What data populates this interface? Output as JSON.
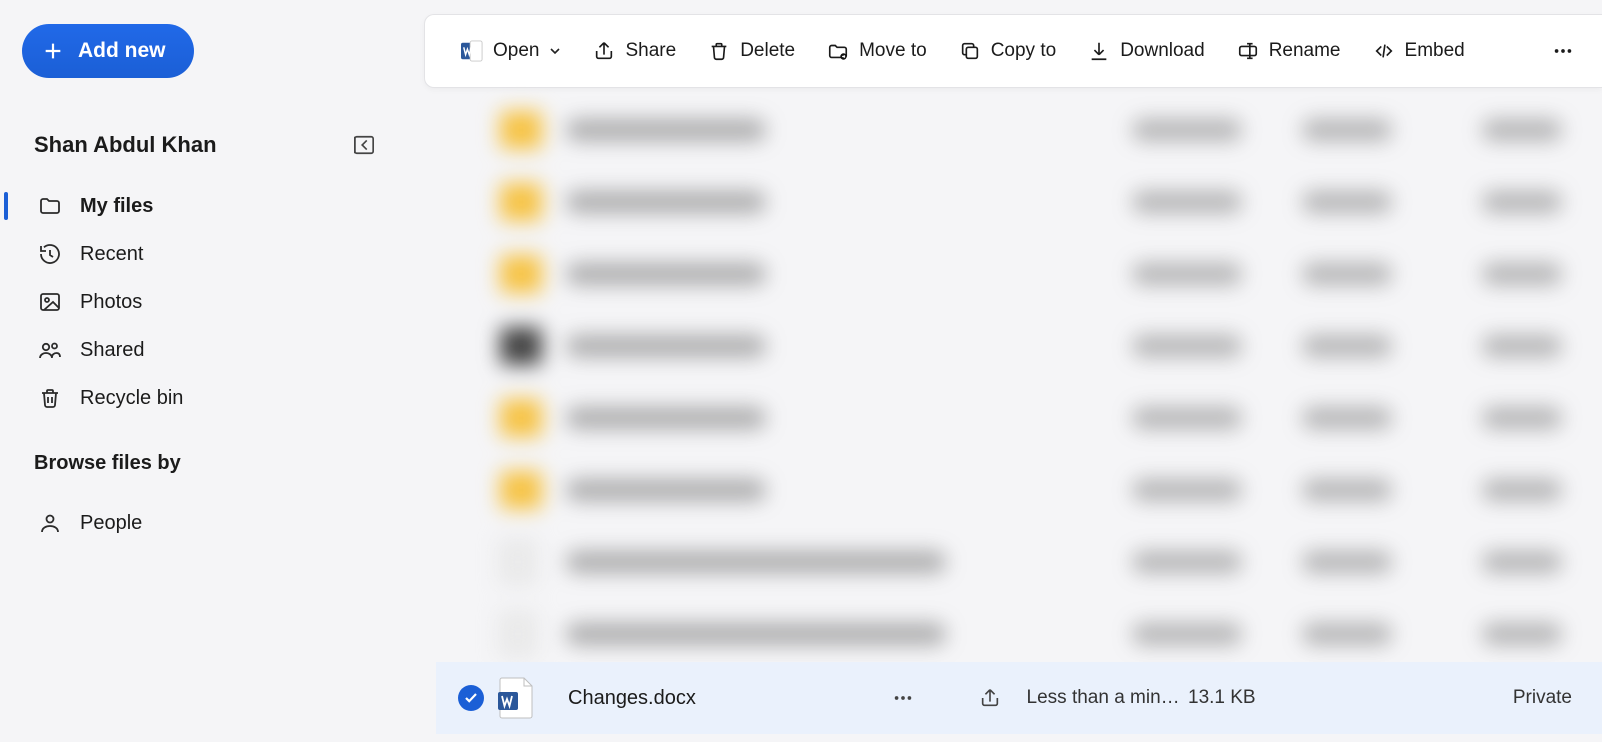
{
  "sidebar": {
    "add_new": "Add new",
    "user_name": "Shan Abdul Khan",
    "nav": [
      {
        "label": "My files",
        "icon": "folder"
      },
      {
        "label": "Recent",
        "icon": "clock"
      },
      {
        "label": "Photos",
        "icon": "image"
      },
      {
        "label": "Shared",
        "icon": "people"
      },
      {
        "label": "Recycle bin",
        "icon": "trash"
      }
    ],
    "browse_header": "Browse files by",
    "browse": [
      {
        "label": "People",
        "icon": "person"
      }
    ]
  },
  "toolbar": {
    "open": "Open",
    "share": "Share",
    "delete": "Delete",
    "move_to": "Move to",
    "copy_to": "Copy to",
    "download": "Download",
    "rename": "Rename",
    "embed": "Embed"
  },
  "selected_file": {
    "name": "Changes.docx",
    "modified": "Less than a minute ago",
    "size": "13.1 KB",
    "sharing": "Private"
  }
}
